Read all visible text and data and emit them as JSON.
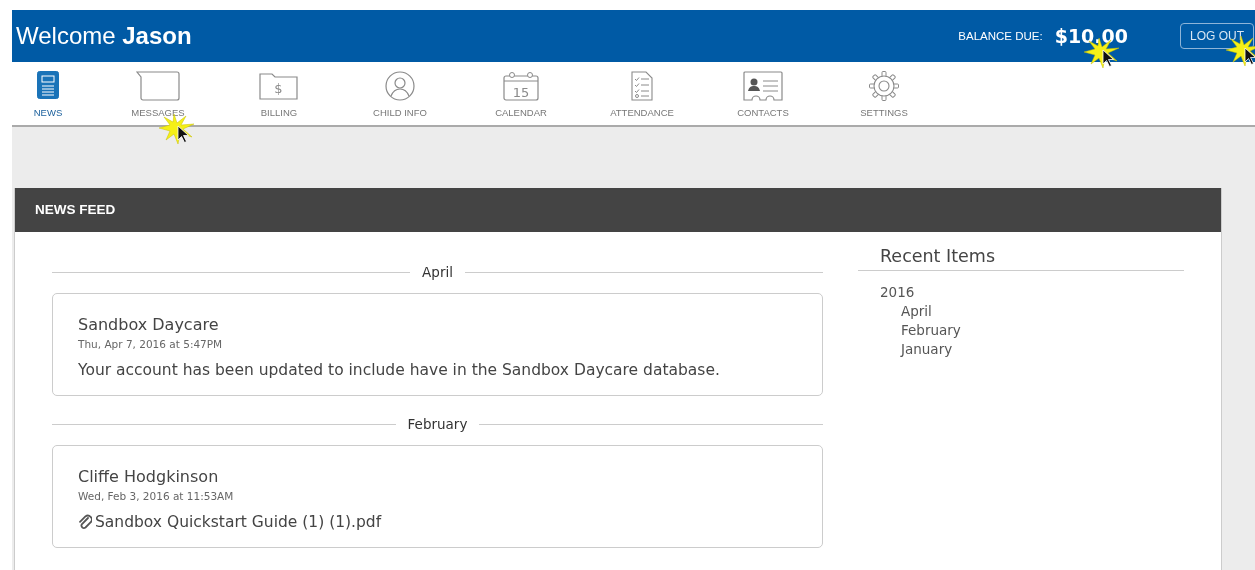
{
  "header": {
    "greeting": "Welcome",
    "user": "Jason",
    "balance_label": "BALANCE DUE:",
    "balance": "$10.00",
    "logout": "LOG OUT"
  },
  "nav": [
    {
      "kind": "news",
      "label": "NEWS",
      "selected": true
    },
    {
      "kind": "messages",
      "label": "MESSAGES",
      "selected": false
    },
    {
      "kind": "billing",
      "label": "BILLING",
      "selected": false
    },
    {
      "kind": "child",
      "label": "CHILD INFO",
      "selected": false
    },
    {
      "kind": "calendar",
      "label": "CALENDAR",
      "selected": false
    },
    {
      "kind": "attendance",
      "label": "ATTENDANCE",
      "selected": false
    },
    {
      "kind": "contacts",
      "label": "CONTACTS",
      "selected": false
    },
    {
      "kind": "settings",
      "label": "SETTINGS",
      "selected": false
    }
  ],
  "calendar_icon_day": "15",
  "billing_icon_symbol": "$",
  "panel_title": "NEWS FEED",
  "feed": [
    {
      "month": "April",
      "posts": [
        {
          "author": "Sandbox Daycare",
          "date": "Thu, Apr 7, 2016 at 5:47PM",
          "kind": "text",
          "body": "Your account has been updated to include have in the Sandbox Daycare database."
        }
      ]
    },
    {
      "month": "February",
      "posts": [
        {
          "author": "Cliffe Hodgkinson",
          "date": "Wed, Feb 3, 2016 at 11:53AM",
          "kind": "attachment",
          "body": "Sandbox Quickstart Guide (1) (1).pdf"
        }
      ]
    }
  ],
  "recent": {
    "title": "Recent Items",
    "years": [
      {
        "label": "2016",
        "children": [
          {
            "label": "April"
          },
          {
            "label": "February"
          },
          {
            "label": "January"
          }
        ]
      }
    ]
  }
}
